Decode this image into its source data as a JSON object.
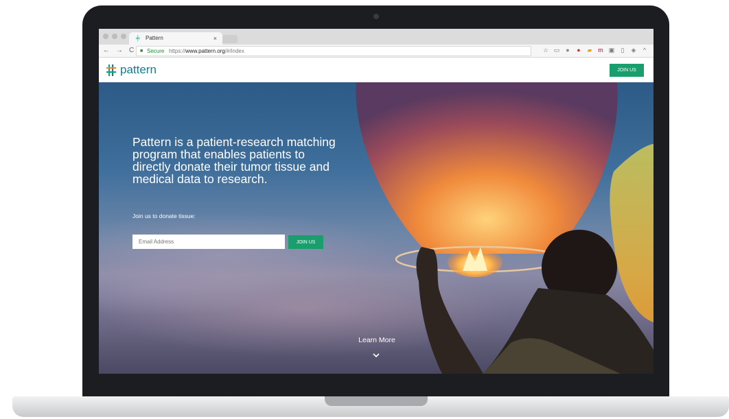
{
  "browser": {
    "tab_title": "Pattern",
    "tab_close": "×",
    "nav_back": "←",
    "nav_forward": "→",
    "nav_reload": "C",
    "secure_label": "Secure",
    "url_scheme": "https://",
    "url_host": "www.pattern.org",
    "url_path": "/#/index"
  },
  "site": {
    "logo_text": "pattern",
    "header_button": "JOIN US",
    "brand_color": "#1a9e6e"
  },
  "hero": {
    "headline": "Pattern is a patient-research matching program that enables patients to directly donate their tumor tissue and medical data to research.",
    "subtext": "Join us to donate tissue:",
    "email_placeholder": "Email Address",
    "join_button": "JOIN US",
    "learn_more": "Learn More",
    "scroll_icon": "chevron-down-icon"
  }
}
